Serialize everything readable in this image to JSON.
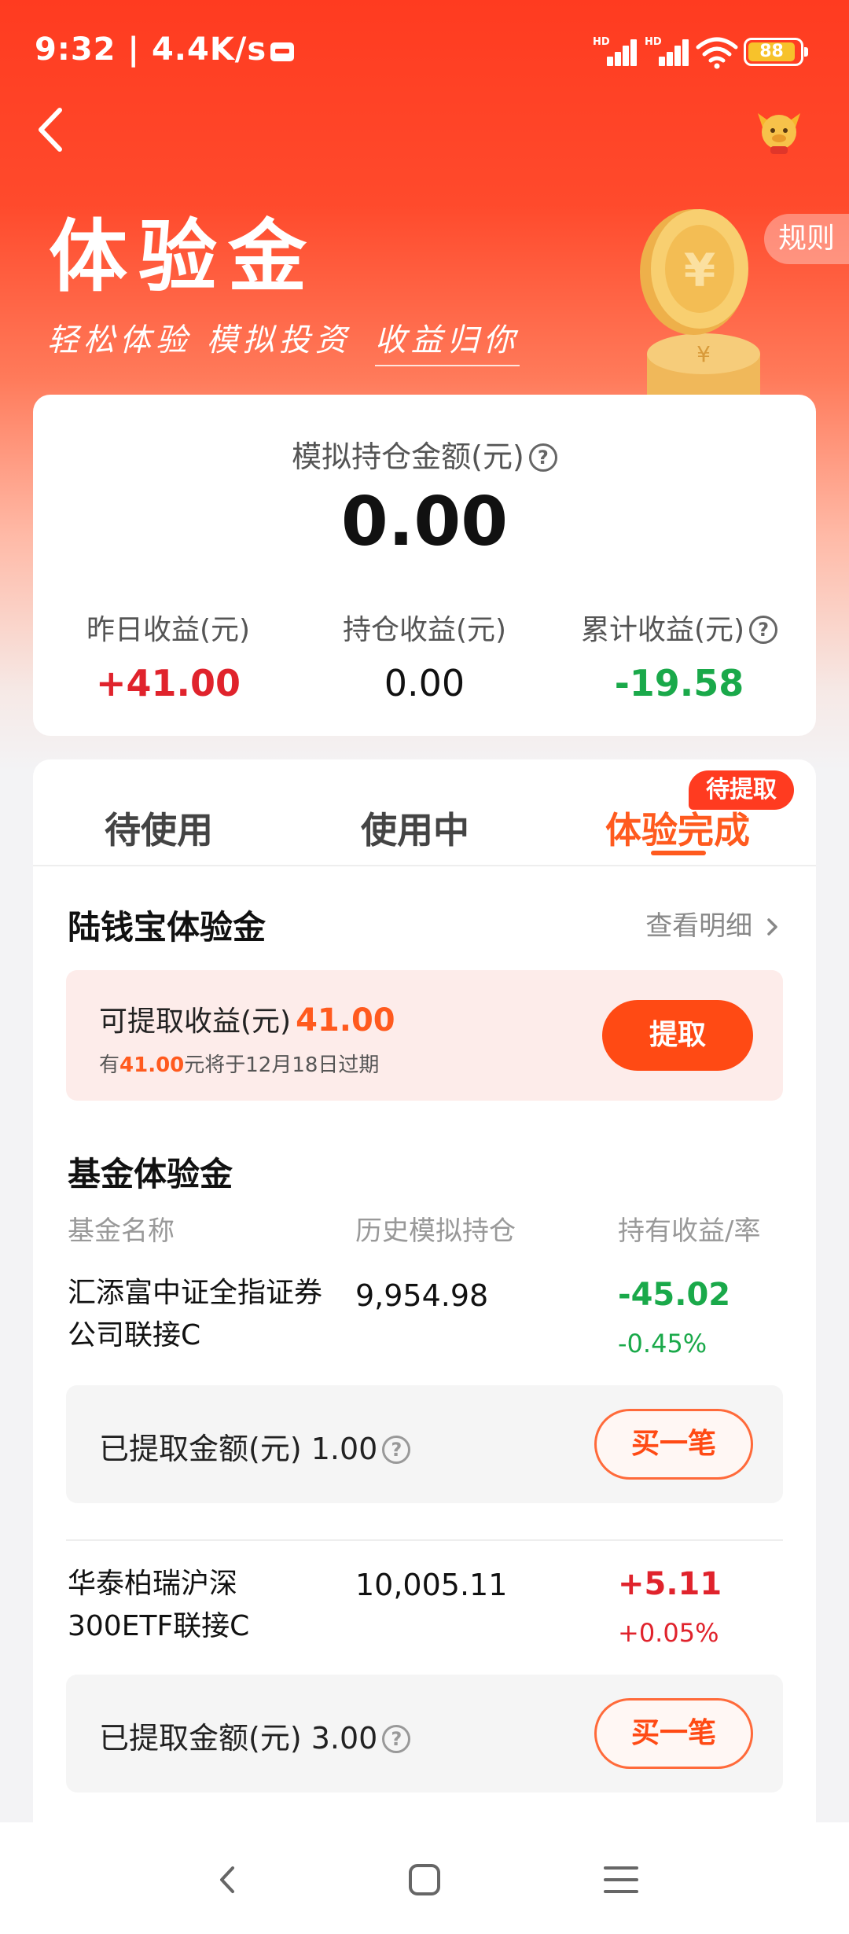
{
  "status_bar": {
    "time": "9:32 | 4.4K/s",
    "signal_1_label": "HD",
    "signal_2_label": "HD",
    "battery": "88"
  },
  "header": {
    "title": "体验金",
    "slogan_left": "轻松体验 模拟投资",
    "slogan_right": "收益归你",
    "rules_label": "规则"
  },
  "summary": {
    "holding_label": "模拟持仓金额(元)",
    "holding_value": "0.00",
    "yesterday_label": "昨日收益(元)",
    "yesterday_value": "+41.00",
    "position_label": "持仓收益(元)",
    "position_value": "0.00",
    "total_label": "累计收益(元)",
    "total_value": "-19.58"
  },
  "tabs": [
    {
      "label": "待使用"
    },
    {
      "label": "使用中"
    },
    {
      "label": "体验完成",
      "badge": "待提取"
    }
  ],
  "lqb": {
    "title": "陆钱宝体验金",
    "detail_link": "查看明细",
    "withdrawable_label": "可提取收益(元)",
    "withdrawable_value": "41.00",
    "expiry_prefix": "有",
    "expiry_amount": "41.00",
    "expiry_suffix": "元将于12月18日过期",
    "withdraw_button": "提取"
  },
  "fund": {
    "title": "基金体验金",
    "col_name": "基金名称",
    "col_history": "历史模拟持仓",
    "col_gain": "持有收益/率",
    "items": [
      {
        "name_line1": "汇添富中证全指证券",
        "name_line2": "公司联接C",
        "holding": "9,954.98",
        "gain": "-45.02",
        "rate": "-0.45%",
        "withdrawn_label": "已提取金额(元)",
        "withdrawn_value": "1.00",
        "buy_button": "买一笔"
      },
      {
        "name_line1": "华泰柏瑞沪深",
        "name_line2": "300ETF联接C",
        "holding": "10,005.11",
        "gain": "+5.11",
        "rate": "+0.05%",
        "withdrawn_label": "已提取金额(元)",
        "withdrawn_value": "3.00",
        "buy_button": "买一笔"
      }
    ]
  },
  "colors": {
    "brand_red": "#ff3b20",
    "accent_orange": "#ff5a1e",
    "gain_red": "#e0232c",
    "loss_green": "#1aa94a"
  },
  "icons": {
    "back": "back-arrow-icon",
    "mascot": "mascot-icon",
    "question": "question-icon",
    "chevron": "chevron-right-icon",
    "nav_back": "nav-back-icon",
    "nav_home": "nav-home-icon",
    "nav_menu": "nav-menu-icon"
  }
}
